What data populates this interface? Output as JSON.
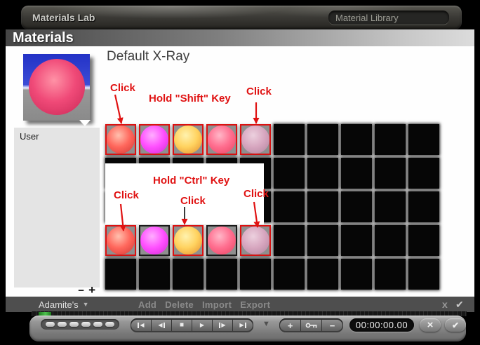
{
  "titlebar": {
    "title": "Materials Lab",
    "library_label": "Material Library"
  },
  "header": {
    "label": "Materials"
  },
  "panel": {
    "material_name": "Default X-Ray",
    "category": "User"
  },
  "annotations": {
    "shift": {
      "left": "Click",
      "center": "Hold \"Shift\" Key",
      "right": "Click"
    },
    "ctrl": {
      "center_top": "Hold \"Ctrl\" Key",
      "left": "Click",
      "center": "Click",
      "right": "Click"
    }
  },
  "footer": {
    "preset": "Adamite's",
    "actions": [
      "Add",
      "Delete",
      "Import",
      "Export"
    ]
  },
  "toolbar": {
    "timecode": "00:00:00.00",
    "transport": [
      {
        "name": "skip-start",
        "parts": [
          "bar",
          "left"
        ]
      },
      {
        "name": "frame-back",
        "parts": [
          "left",
          "bar"
        ]
      },
      {
        "name": "stop",
        "parts": [
          "stop"
        ]
      },
      {
        "name": "play",
        "parts": [
          "right"
        ]
      },
      {
        "name": "frame-forward",
        "parts": [
          "bar",
          "right"
        ]
      },
      {
        "name": "skip-end",
        "parts": [
          "right",
          "bar"
        ]
      }
    ]
  },
  "icons": {
    "caret_down": "▼",
    "check": "✔",
    "close_x": "×",
    "footer_close": "x",
    "minus": "−",
    "plus": "+",
    "left": "◀",
    "right": "▶",
    "stop": "■"
  },
  "colors": {
    "annotation_red": "#e01212",
    "selection_red": "#dd1111",
    "unselected_border": "#1a1a1a",
    "tile_gray": "#8f8f8f",
    "slot_black": "#060606"
  },
  "preview": {
    "sky": "#2332c6",
    "horizon": "#eef1ff",
    "ground": "#8a8a8a",
    "sphere": {
      "hi": "#ff92a6",
      "mid": "#f04a78",
      "lo": "#d63462"
    }
  },
  "sphere_colors": {
    "red": {
      "hi": "#ffc0ae",
      "mid": "#ff675c",
      "lo": "#de4640"
    },
    "magenta": {
      "hi": "#ffaeff",
      "mid": "#ff50ff",
      "lo": "#df34df"
    },
    "gold": {
      "hi": "#fff2ae",
      "mid": "#ffd25f",
      "lo": "#ec9f3a"
    },
    "pink": {
      "hi": "#ffb7c8",
      "mid": "#ff6e8f",
      "lo": "#ef4f6e"
    },
    "mauve": {
      "hi": "#ecd0de",
      "mid": "#d7a6bf",
      "lo": "#bb8da7"
    }
  },
  "grid": {
    "tile": 44,
    "gap": 4,
    "rows": [
      [
        {
          "c": "red",
          "sel": true
        },
        {
          "c": "magenta",
          "sel": true
        },
        {
          "c": "gold",
          "sel": true
        },
        {
          "c": "pink",
          "sel": true
        },
        {
          "c": "mauve",
          "sel": true
        },
        null,
        null,
        null,
        null,
        null
      ],
      [
        null,
        null,
        null,
        null,
        null,
        null,
        null,
        null,
        null,
        null
      ],
      [
        null,
        null,
        null,
        null,
        null,
        null,
        null,
        null,
        null,
        null
      ],
      [
        {
          "c": "red",
          "sel": true
        },
        {
          "c": "magenta",
          "sel": false
        },
        {
          "c": "gold",
          "sel": true
        },
        {
          "c": "pink",
          "sel": false
        },
        {
          "c": "mauve",
          "sel": true
        },
        null,
        null,
        null,
        null,
        null
      ],
      [
        null,
        null,
        null,
        null,
        null,
        null,
        null,
        null,
        null,
        null
      ]
    ]
  }
}
